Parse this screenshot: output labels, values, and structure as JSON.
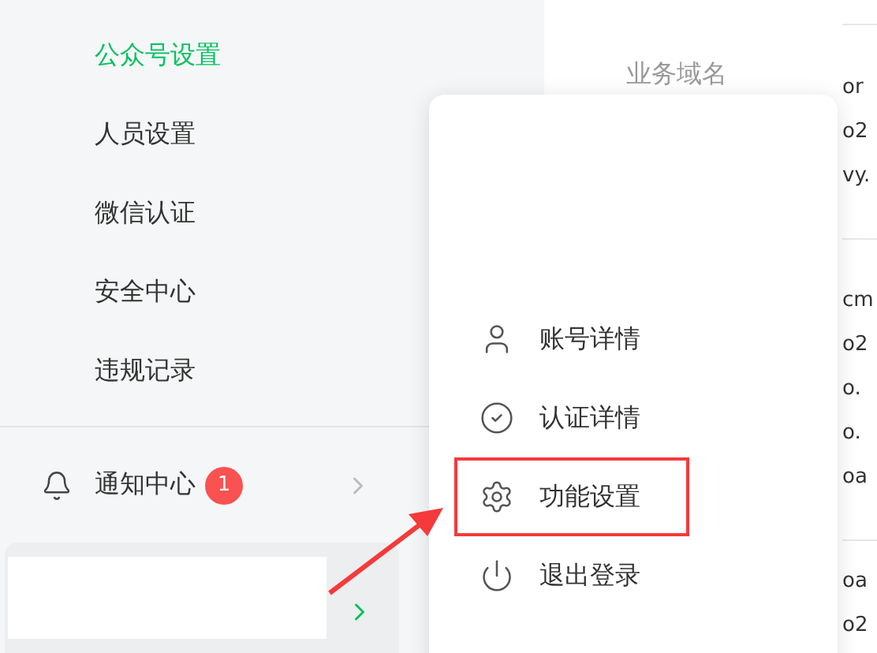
{
  "sidebar": {
    "items": [
      {
        "label": "公众号设置",
        "selected": true
      },
      {
        "label": "人员设置",
        "selected": false
      },
      {
        "label": "微信认证",
        "selected": false
      },
      {
        "label": "安全中心",
        "selected": false
      },
      {
        "label": "违规记录",
        "selected": false
      }
    ],
    "notification": {
      "label": "通知中心",
      "badge": "1"
    }
  },
  "content": {
    "sections": [
      {
        "label": "业务域名",
        "values": [
          "or",
          "o2",
          "vy."
        ]
      },
      {
        "values": [
          "cm",
          "o2",
          "o.",
          "o.",
          "oa"
        ]
      },
      {
        "values": [
          "oa",
          "o2"
        ]
      }
    ]
  },
  "account_menu": {
    "items": [
      {
        "kind": "account",
        "label": "账号详情",
        "highlighted": false
      },
      {
        "kind": "verify",
        "label": "认证详情",
        "highlighted": false
      },
      {
        "kind": "settings",
        "label": "功能设置",
        "highlighted": true
      },
      {
        "kind": "logout",
        "label": "退出登录",
        "highlighted": false
      }
    ]
  }
}
